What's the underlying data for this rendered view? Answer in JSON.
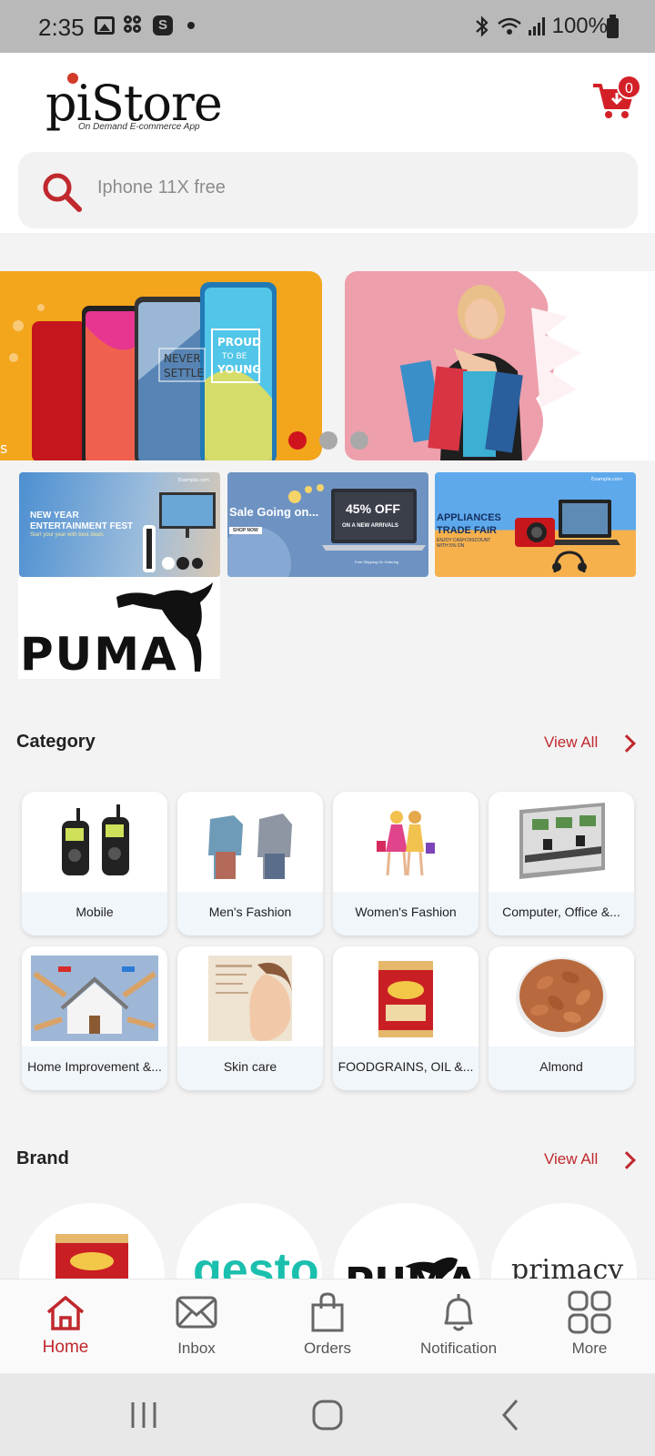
{
  "status_bar": {
    "time": "2:35",
    "battery": "100%"
  },
  "header": {
    "logo_text": "piStore",
    "logo_tagline": "On Demand E-commerce App",
    "cart_count": "0"
  },
  "search": {
    "placeholder": "Iphone 11X free"
  },
  "banners": {
    "slide1_text_a": "NEVER",
    "slide1_text_b": "SETTLE",
    "slide1_text_c": "PROUD",
    "slide1_text_d": "TO BE",
    "slide1_text_e": "YOUNG",
    "slide1_edge": "s",
    "dots_count": 3,
    "active_dot": 0
  },
  "promos": [
    {
      "title_line1": "NEW YEAR",
      "title_line2": "ENTERTAINMENT FEST",
      "subtitle": "Start your year with best deals",
      "corner": "Example.com"
    },
    {
      "title": "Sale Going on...",
      "offer": "45% OFF",
      "offer_sub": "ON A NEW ARRIVALS",
      "button": "SHOP NOW",
      "footer": "Free Shipping On Ordering"
    },
    {
      "title_line1": "APPLIANCES",
      "title_line2": "TRADE FAIR",
      "subtitle_line1": "ENJOY CASH DISCOUNT",
      "subtitle_line2": "WITH 5% ON",
      "corner": "Example.com"
    }
  ],
  "puma_tile": {
    "text": "PUMA"
  },
  "category": {
    "title": "Category",
    "view_all": "View All",
    "items": [
      {
        "label": "Mobile"
      },
      {
        "label": "Men's Fashion"
      },
      {
        "label": "Women's Fashion"
      },
      {
        "label": "Computer, Office &..."
      },
      {
        "label": "Home Improvement &..."
      },
      {
        "label": "Skin care"
      },
      {
        "label": "FOODGRAINS, OIL &..."
      },
      {
        "label": "Almond"
      }
    ]
  },
  "brand": {
    "title": "Brand",
    "view_all": "View All",
    "items": [
      {
        "name": ""
      },
      {
        "name": "gesto"
      },
      {
        "name": "PUMA"
      },
      {
        "name": "primacy"
      }
    ]
  },
  "bottom_nav": {
    "items": [
      {
        "label": "Home",
        "icon": "home-icon",
        "active": true
      },
      {
        "label": "Inbox",
        "icon": "inbox-icon"
      },
      {
        "label": "Orders",
        "icon": "shopping-bag-icon"
      },
      {
        "label": "Notification",
        "icon": "bell-icon"
      },
      {
        "label": "More",
        "icon": "grid-icon"
      }
    ]
  },
  "colors": {
    "accent": "#c0282d",
    "badge": "#d32027",
    "banner_orange": "#f3a51c",
    "banner_pink": "#eea4b0"
  }
}
